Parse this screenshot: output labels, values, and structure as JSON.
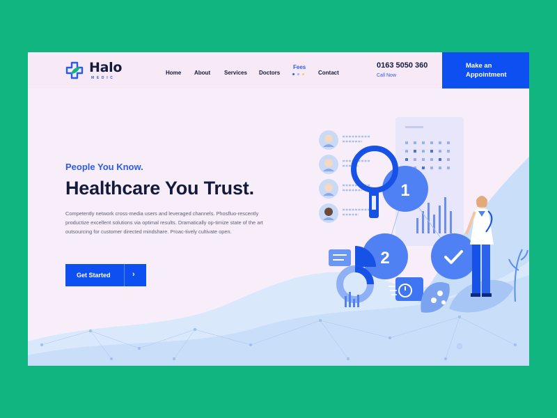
{
  "brand": {
    "name": "Halo",
    "tagline": "MEDIC",
    "accent": "#0e4ff1",
    "dark": "#141a3a",
    "green": "#10b57f"
  },
  "nav": {
    "items": [
      {
        "label": "Home"
      },
      {
        "label": "About"
      },
      {
        "label": "Services"
      },
      {
        "label": "Doctors"
      },
      {
        "label": "Fees",
        "active": true
      },
      {
        "label": "Contact"
      }
    ]
  },
  "contact": {
    "phone": "0163 5050 360",
    "call_label": "Call Now"
  },
  "appointment_button": {
    "line1": "Make an",
    "line2": "Appointment"
  },
  "hero": {
    "eyebrow": "People You Know.",
    "headline": "Healthcare You Trust.",
    "body": "Competently network cross-media users and leveraged channels. Phosfluo-rescently productize excellent solutions via optimal results. Dramatically op-timize state of the art outsourcing for customer directed mindshare. Proac-tively cultivate open.",
    "cta_label": "Get Started",
    "cta_icon": "chevron-right-icon"
  },
  "illustration": {
    "steps": [
      "1",
      "2"
    ],
    "icons": [
      "magnifier-icon",
      "check-icon",
      "stopwatch-icon",
      "chat-icon",
      "doctor-figure",
      "avatar-icon"
    ]
  }
}
